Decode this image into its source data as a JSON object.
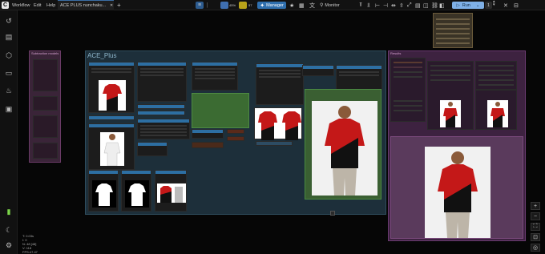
{
  "topbar": {
    "logo": "C",
    "menu": [
      "Workflow",
      "Edit",
      "Help"
    ],
    "tab_label": "ACE PLUS nunchaku...",
    "add_tab": "+",
    "queue_pct_1": "45%",
    "queue_pct_2": "57",
    "manager_label": "Manager",
    "monitor_label": "Monitor",
    "run_label": "Run",
    "run_count": "1"
  },
  "canvas": {
    "group_main": "ACE_Plus",
    "group_left": "Subtraction models",
    "group_right": "Results"
  },
  "status": {
    "lines": [
      "T: 0.03s",
      "I: 0",
      "N: 48 [48]",
      "V: 118",
      "FPS:47.47"
    ]
  },
  "colors": {
    "node_header": "#2d6fa3",
    "accent": "#3a6ea5"
  }
}
